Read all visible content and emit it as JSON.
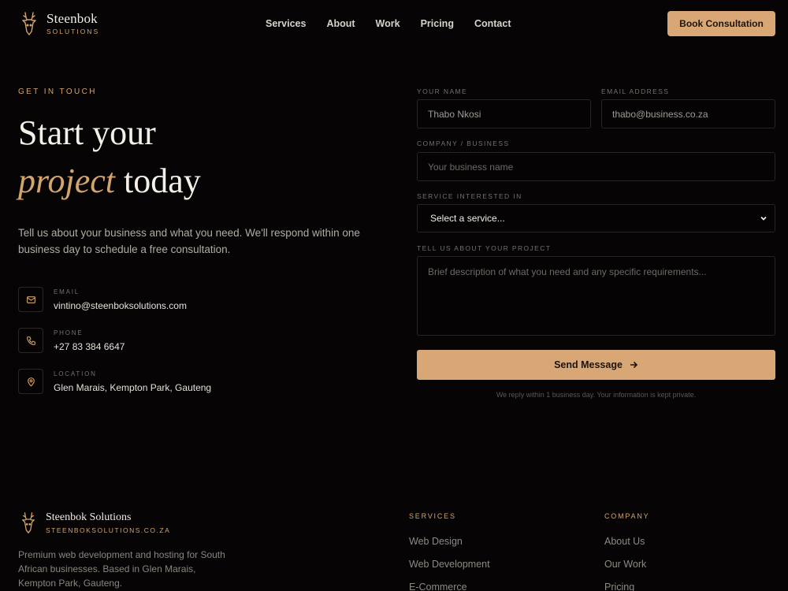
{
  "brand": {
    "name": "Steenbok",
    "subtitle": "SOLUTIONS",
    "accent": "#d3a46e",
    "button_color": "#d9a775"
  },
  "nav": {
    "items": [
      "Services",
      "About",
      "Work",
      "Pricing",
      "Contact"
    ],
    "cta": "Book Consultation"
  },
  "hero": {
    "eyebrow": "GET IN TOUCH",
    "line1": "Start your",
    "line2_accent": "project",
    "line2_rest": " today",
    "intro": "Tell us about your business and what you need. We'll respond within one business day to schedule a free consultation."
  },
  "contact": [
    {
      "label": "EMAIL",
      "value": "vintino@steenboksolutions.com",
      "icon": "mail-icon"
    },
    {
      "label": "PHONE",
      "value": "+27 83 384 6647",
      "icon": "phone-icon"
    },
    {
      "label": "LOCATION",
      "value": "Glen Marais, Kempton Park, Gauteng",
      "icon": "location-pin-icon"
    }
  ],
  "form": {
    "name_label": "YOUR NAME",
    "name_value": "Thabo Nkosi",
    "email_label": "EMAIL ADDRESS",
    "email_value": "thabo@business.co.za",
    "company_label": "COMPANY / BUSINESS",
    "company_placeholder": "Your business name",
    "service_label": "SERVICE INTERESTED IN",
    "service_selected": "Select a service...",
    "project_label": "TELL US ABOUT YOUR PROJECT",
    "project_placeholder": "Brief description of what you need and any specific requirements...",
    "submit_label": "Send Message",
    "note": "We reply within 1 business day. Your information is kept private."
  },
  "footer": {
    "brand_name": "Steenbok Solutions",
    "domain": "STEENBOKSOLUTIONS.CO.ZA",
    "description": "Premium web development and hosting for South African businesses. Based in Glen Marais, Kempton Park, Gauteng.",
    "services_heading": "SERVICES",
    "services_links": [
      "Web Design",
      "Web Development",
      "E-Commerce"
    ],
    "company_heading": "COMPANY",
    "company_links": [
      "About Us",
      "Our Work",
      "Pricing"
    ]
  }
}
